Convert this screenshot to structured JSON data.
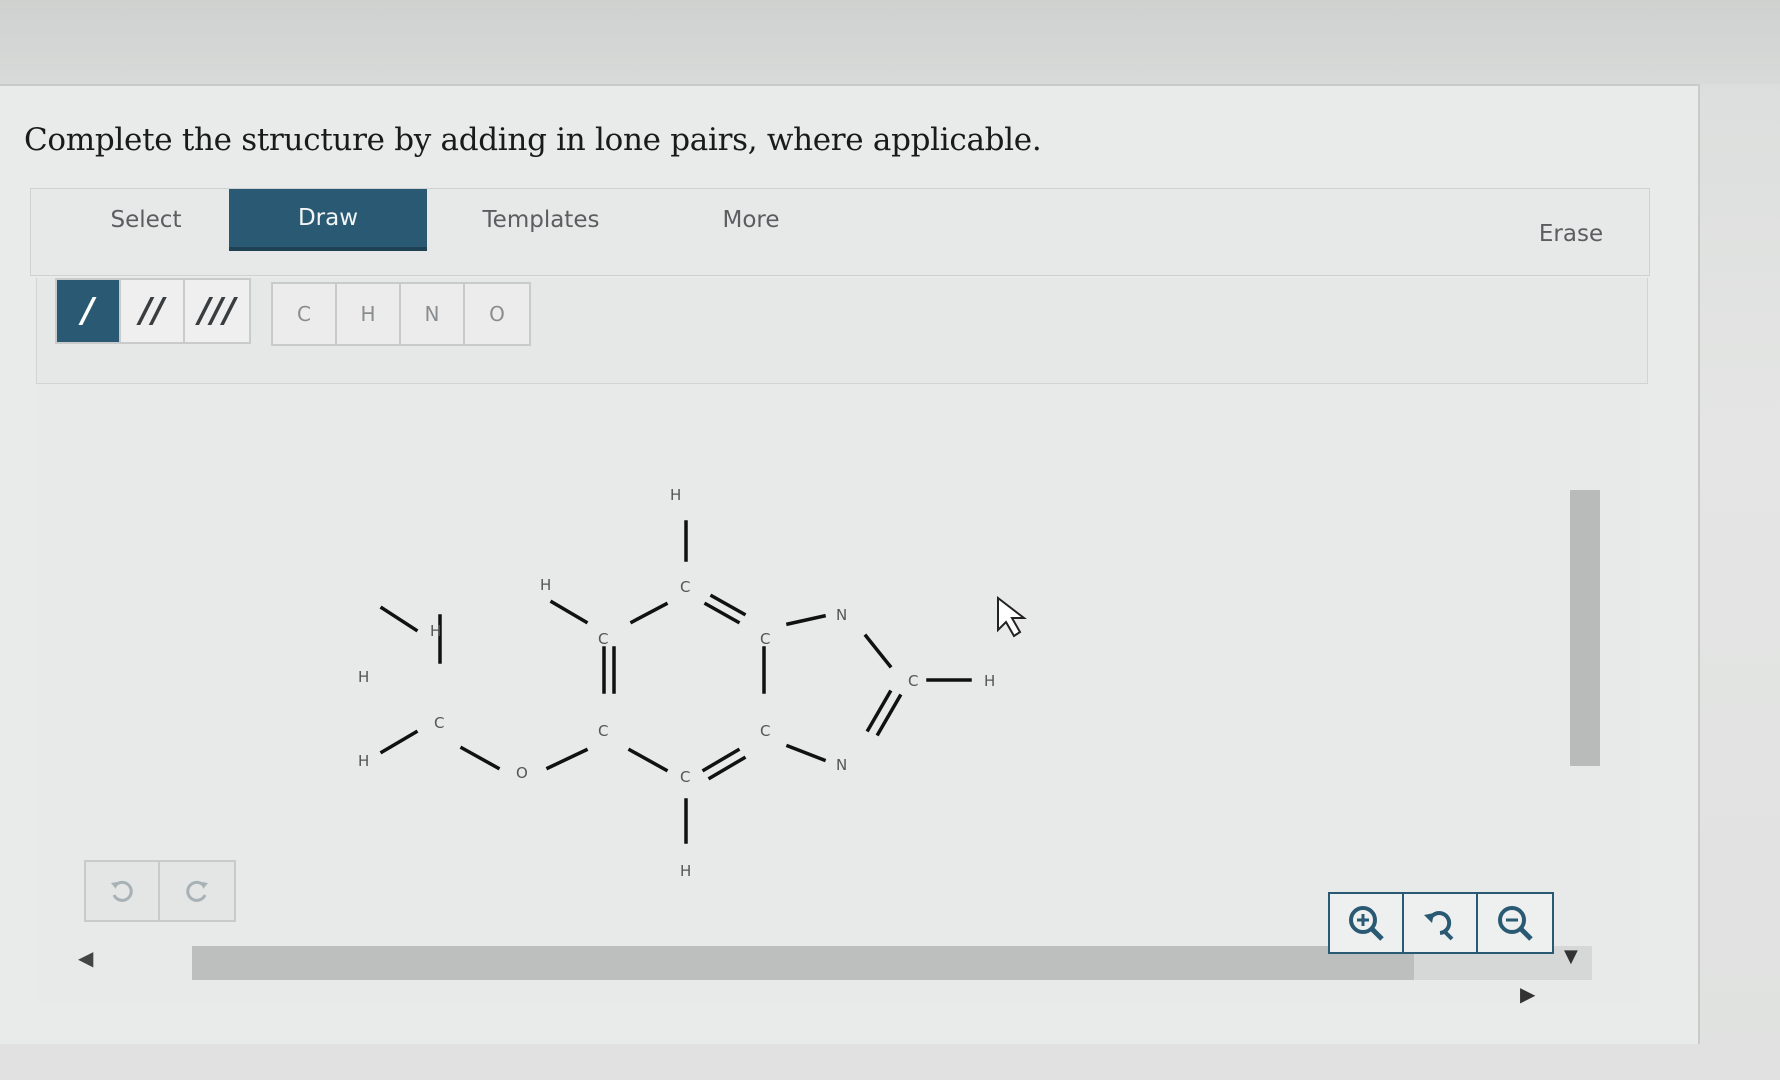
{
  "prompt": "Complete the structure by adding in lone pairs, where applicable.",
  "tabs": [
    {
      "label": "Select",
      "active": false
    },
    {
      "label": "Draw",
      "active": true
    },
    {
      "label": "Templates",
      "active": false
    },
    {
      "label": "More",
      "active": false
    }
  ],
  "erase_label": "Erase",
  "bond_tools": [
    {
      "name": "single-bond",
      "glyph": "/",
      "active": true
    },
    {
      "name": "double-bond",
      "glyph": "//",
      "active": false
    },
    {
      "name": "triple-bond",
      "glyph": "///",
      "active": false
    }
  ],
  "atom_tools": [
    "C",
    "H",
    "N",
    "O"
  ],
  "molecule": {
    "atoms": [
      "H",
      "H",
      "H",
      "C",
      "O",
      "H",
      "C",
      "C",
      "C",
      "H",
      "C",
      "H",
      "C",
      "C",
      "N",
      "C",
      "H",
      "N"
    ]
  },
  "undo": {
    "undo_icon": "undo-icon",
    "redo_icon": "redo-icon"
  },
  "zoom": {
    "zoom_in_icon": "zoom-in-icon",
    "reset_icon": "zoom-reset-icon",
    "zoom_out_icon": "zoom-out-icon"
  },
  "colors": {
    "accent": "#2a5a73",
    "panel": "#e9eaea"
  }
}
